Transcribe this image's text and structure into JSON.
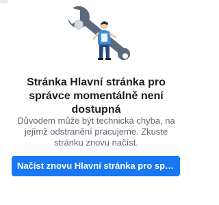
{
  "error": {
    "illustration_icon": "wrench-person-icon",
    "title": "Stránka Hlavní stránka pro správce momentálně není dostupná",
    "description": "Důvodem může být technická chyba, na jejímž odstranění pracujeme. Zkuste stránku znovu načíst.",
    "reload_label": "Načíst znovu Hlavní stránka pro spr..."
  },
  "colors": {
    "accent": "#1877f2",
    "title_text": "#1c1e21",
    "body_text": "#606770",
    "wrench": "#5b6a7a",
    "person_accent": "#3b8ed6"
  }
}
